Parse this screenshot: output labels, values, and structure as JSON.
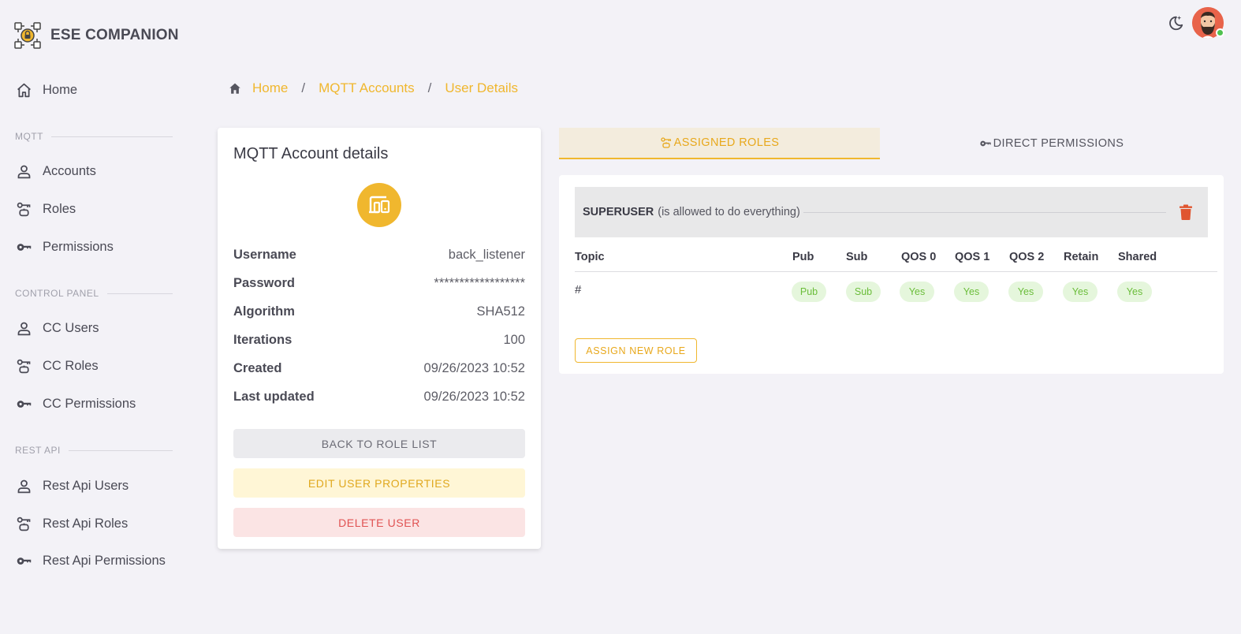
{
  "app": {
    "title": "ESE COMPANION"
  },
  "sidebar": {
    "home": "Home",
    "sections": [
      {
        "label": "MQTT",
        "items": [
          "Accounts",
          "Roles",
          "Permissions"
        ]
      },
      {
        "label": "CONTROL PANEL",
        "items": [
          "CC Users",
          "CC Roles",
          "CC Permissions"
        ]
      },
      {
        "label": "REST API",
        "items": [
          "Rest Api Users",
          "Rest Api Roles",
          "Rest Api Permissions"
        ]
      }
    ]
  },
  "breadcrumb": {
    "items": [
      "Home",
      "MQTT Accounts",
      "User Details"
    ],
    "separator": "/"
  },
  "details": {
    "title": "MQTT Account details",
    "rows": [
      {
        "label": "Username",
        "value": "back_listener"
      },
      {
        "label": "Password",
        "value": "******************"
      },
      {
        "label": "Algorithm",
        "value": "SHA512"
      },
      {
        "label": "Iterations",
        "value": "100"
      },
      {
        "label": "Created",
        "value": "09/26/2023 10:52"
      },
      {
        "label": "Last updated",
        "value": "09/26/2023 10:52"
      }
    ],
    "buttons": {
      "back": "BACK TO ROLE LIST",
      "edit": "EDIT USER PROPERTIES",
      "delete": "DELETE USER"
    }
  },
  "tabs": {
    "assigned_roles": "ASSIGNED ROLES",
    "direct_permissions": "DIRECT PERMISSIONS"
  },
  "role": {
    "name": "SUPERUSER",
    "description": "(is allowed to do everything)",
    "columns": [
      "Topic",
      "Pub",
      "Sub",
      "QOS 0",
      "QOS 1",
      "QOS 2",
      "Retain",
      "Shared"
    ],
    "row": {
      "topic": "#",
      "values": [
        "Pub",
        "Sub",
        "Yes",
        "Yes",
        "Yes",
        "Yes",
        "Yes"
      ]
    }
  },
  "assign_button": "ASSIGN NEW ROLE",
  "colors": {
    "accent": "#f0b72e",
    "danger": "#e05252",
    "success": "#6bbd3a",
    "background": "#f3f2f7"
  },
  "icons": [
    "app-logo-icon",
    "home-icon",
    "person-icon",
    "roles-icon",
    "key-icon",
    "moon-star-icon",
    "avatar-icon",
    "devices-icon",
    "trash-icon"
  ]
}
